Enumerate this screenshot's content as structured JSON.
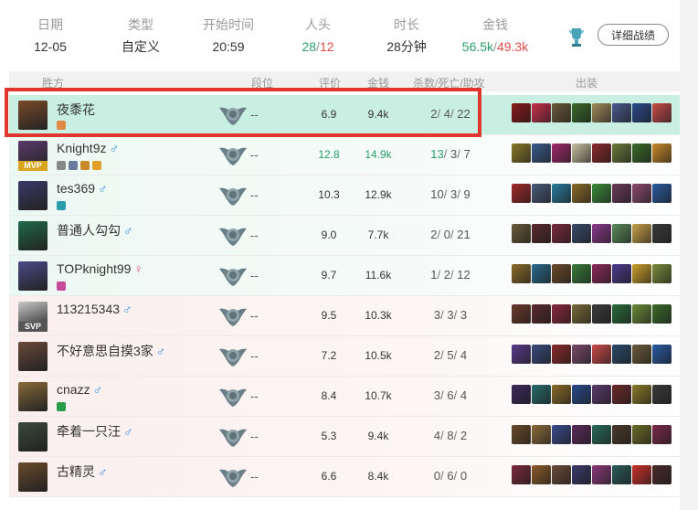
{
  "summary": {
    "date_label": "日期",
    "date": "12-05",
    "type_label": "类型",
    "type": "自定义",
    "start_label": "开始时间",
    "start": "20:59",
    "kills_label": "人头",
    "kills_win": "28",
    "kills_sep": "/",
    "kills_loss": "12",
    "duration_label": "时长",
    "duration": "28分钟",
    "gold_label": "金钱",
    "gold_win": "56.5k",
    "gold_sep": "/",
    "gold_loss": "49.3k",
    "detail_button": "详细战绩"
  },
  "table_headers": {
    "winner": "胜方",
    "rank": "段位",
    "score": "评价",
    "gold": "金钱",
    "kda": "杀数/死亡/助攻",
    "items": "出装"
  },
  "players": [
    {
      "name": "夜黍花",
      "gender": "",
      "rank": "--",
      "score": "6.9",
      "gold": "9.4k",
      "k": "2",
      "d": "4",
      "a": "22",
      "team": "win",
      "badge": ""
    },
    {
      "name": "Knight9z",
      "gender": "♂",
      "rank": "--",
      "score": "12.8",
      "gold": "14.9k",
      "k": "13",
      "d": "3",
      "a": "7",
      "team": "win",
      "badge": "MVP"
    },
    {
      "name": "tes369",
      "gender": "♂",
      "rank": "--",
      "score": "10.3",
      "gold": "12.9k",
      "k": "10",
      "d": "3",
      "a": "9",
      "team": "win",
      "badge": ""
    },
    {
      "name": "普通人勾勾",
      "gender": "♂",
      "rank": "--",
      "score": "9.0",
      "gold": "7.7k",
      "k": "2",
      "d": "0",
      "a": "21",
      "team": "win",
      "badge": ""
    },
    {
      "name": "TOPknight99",
      "gender": "♀",
      "rank": "--",
      "score": "9.7",
      "gold": "11.6k",
      "k": "1",
      "d": "2",
      "a": "12",
      "team": "win",
      "badge": ""
    },
    {
      "name": "113215343",
      "gender": "♂",
      "rank": "--",
      "score": "9.5",
      "gold": "10.3k",
      "k": "3",
      "d": "3",
      "a": "3",
      "team": "loss",
      "badge": "SVP"
    },
    {
      "name": "不好意思自摸3家",
      "gender": "♂",
      "rank": "--",
      "score": "7.2",
      "gold": "10.5k",
      "k": "2",
      "d": "5",
      "a": "4",
      "team": "loss",
      "badge": ""
    },
    {
      "name": "cnazz",
      "gender": "♂",
      "rank": "--",
      "score": "8.4",
      "gold": "10.7k",
      "k": "3",
      "d": "6",
      "a": "4",
      "team": "loss",
      "badge": ""
    },
    {
      "name": "牵着一只汪",
      "gender": "♂",
      "rank": "--",
      "score": "5.3",
      "gold": "9.4k",
      "k": "4",
      "d": "8",
      "a": "2",
      "team": "loss",
      "badge": ""
    },
    {
      "name": "古精灵",
      "gender": "♂",
      "rank": "--",
      "score": "6.6",
      "gold": "8.4k",
      "k": "0",
      "d": "6",
      "a": "0",
      "team": "loss",
      "badge": ""
    }
  ],
  "colors": {
    "win_text": "#2a9d6a",
    "loss_text": "#e04a4a",
    "highlight_border": "#e0362e",
    "highlight_row": "#c9efe2"
  }
}
